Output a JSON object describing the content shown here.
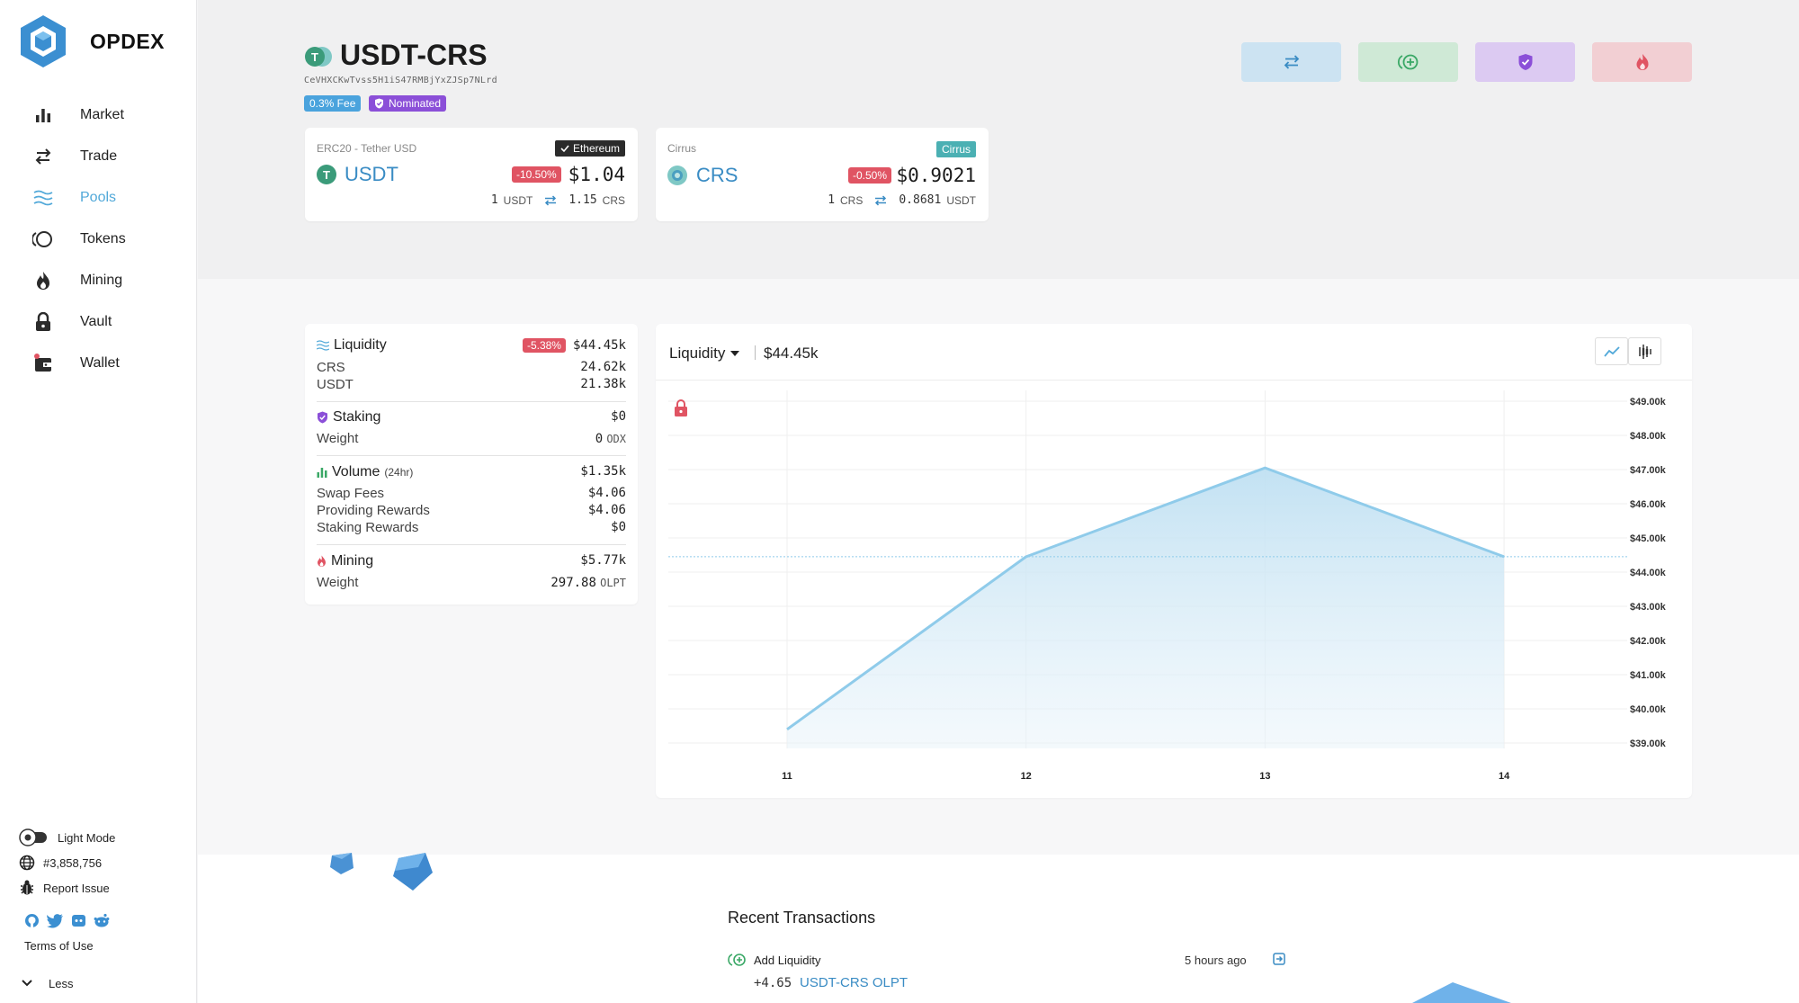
{
  "app": {
    "name": "OPDEX"
  },
  "sidebar": {
    "items": [
      {
        "label": "Market",
        "icon": "bar-chart-icon",
        "active": false
      },
      {
        "label": "Trade",
        "icon": "swap-icon",
        "active": false
      },
      {
        "label": "Pools",
        "icon": "waves-icon",
        "active": true
      },
      {
        "label": "Tokens",
        "icon": "tokens-icon",
        "active": false
      },
      {
        "label": "Mining",
        "icon": "flame-icon",
        "active": false
      },
      {
        "label": "Vault",
        "icon": "lock-icon",
        "active": false
      },
      {
        "label": "Wallet",
        "icon": "wallet-icon",
        "active": false
      }
    ],
    "footer": {
      "theme_label": "Light Mode",
      "block_label": "#3,858,756",
      "report_label": "Report Issue",
      "terms_label": "Terms of Use",
      "less_label": "Less",
      "social_icons": [
        "github-icon",
        "twitter-icon",
        "discord-icon",
        "reddit-icon"
      ]
    }
  },
  "pool": {
    "title": "USDT-CRS",
    "address": "CeVHXCKwTvss5H1iS47RMBjYxZJSp7NLrd",
    "fee_badge": "0.3% Fee",
    "nominated_badge": "Nominated"
  },
  "tokens": [
    {
      "subtitle": "ERC20 - Tether USD",
      "chain": "Ethereum",
      "symbol": "USDT",
      "change": "-10.50%",
      "price": "$1.04",
      "rate_left_value": "1",
      "rate_left_unit": "USDT",
      "rate_right_value": "1.15",
      "rate_right_unit": "CRS"
    },
    {
      "subtitle": "Cirrus",
      "chain": "Cirrus",
      "symbol": "CRS",
      "change": "-0.50%",
      "price": "$0.9021",
      "rate_left_value": "1",
      "rate_left_unit": "CRS",
      "rate_right_value": "0.8681",
      "rate_right_unit": "USDT"
    }
  ],
  "stats": {
    "liquidity": {
      "label": "Liquidity",
      "change": "-5.38%",
      "value": "$44.45k"
    },
    "crs": {
      "label": "CRS",
      "value": "24.62k"
    },
    "usdt": {
      "label": "USDT",
      "value": "21.38k"
    },
    "staking": {
      "label": "Staking",
      "value": "$0"
    },
    "staking_weight": {
      "label": "Weight",
      "value": "0",
      "unit": "ODX"
    },
    "volume": {
      "label": "Volume",
      "sub": "(24hr)",
      "value": "$1.35k"
    },
    "swap_fees": {
      "label": "Swap Fees",
      "value": "$4.06"
    },
    "providing_rewards": {
      "label": "Providing Rewards",
      "value": "$4.06"
    },
    "staking_rewards": {
      "label": "Staking Rewards",
      "value": "$0"
    },
    "mining": {
      "label": "Mining",
      "value": "$5.77k"
    },
    "mining_weight": {
      "label": "Weight",
      "value": "297.88",
      "unit": "OLPT"
    }
  },
  "chart_panel": {
    "selector_label": "Liquidity",
    "current_value": "$44.45k"
  },
  "chart_data": {
    "type": "area",
    "x": [
      "11",
      "12",
      "13",
      "14"
    ],
    "series": [
      {
        "values": [
          39400,
          44450,
          47050,
          44450
        ]
      }
    ],
    "y_ticks": [
      "$39.00k",
      "$40.00k",
      "$41.00k",
      "$42.00k",
      "$43.00k",
      "$44.00k",
      "$45.00k",
      "$46.00k",
      "$47.00k",
      "$48.00k",
      "$49.00k"
    ],
    "ylim": [
      39000,
      49000
    ],
    "current_line": 44450,
    "grid": true,
    "line_color": "#8fcbea"
  },
  "transactions": {
    "title": "Recent Transactions",
    "items": [
      {
        "type": "Add Liquidity",
        "time": "5 hours ago",
        "amount": "+4.65",
        "token": "USDT-CRS OLPT"
      }
    ]
  },
  "colors": {
    "accent": "#52a9d9",
    "negative": "#e05463",
    "nominated": "#8b4fd8",
    "ethereum": "#2b2b2b",
    "cirrus": "#4bb0b3"
  }
}
